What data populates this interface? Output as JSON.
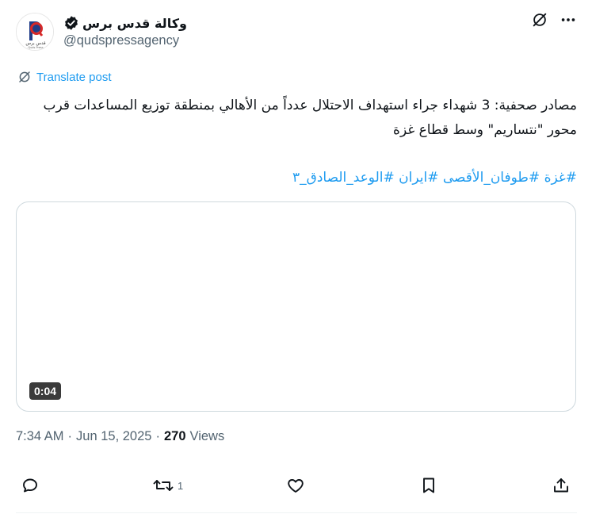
{
  "author": {
    "display_name": "وكالة قدس برس",
    "handle": "@qudspressagency",
    "verified": true,
    "avatar_text": "قدس برس",
    "avatar_subtext": "Quds Press"
  },
  "translate_label": "Translate post",
  "post_text": "مصادر صحفية: 3 شهداء جراء استهداف الاحتلال عدداً من الأهالي بمنطقة توزيع المساعدات قرب محور \"نتساريم\" وسط قطاع غزة",
  "hashtags": [
    "#غزة",
    "#طوفان_الأقصى",
    "#ايران",
    "#الوعد_الصادق_٣"
  ],
  "media": {
    "duration": "0:04"
  },
  "meta": {
    "time": "7:34 AM",
    "date": "Jun 15, 2025",
    "views_count": "270",
    "views_label": "Views",
    "separator": "·"
  },
  "actions": {
    "reply_count": "",
    "repost_count": "1",
    "like_count": "",
    "bookmark_count": ""
  },
  "colors": {
    "accent": "#1d9bf0",
    "text": "#0f1419",
    "muted": "#536471",
    "border": "#cfd9de"
  }
}
